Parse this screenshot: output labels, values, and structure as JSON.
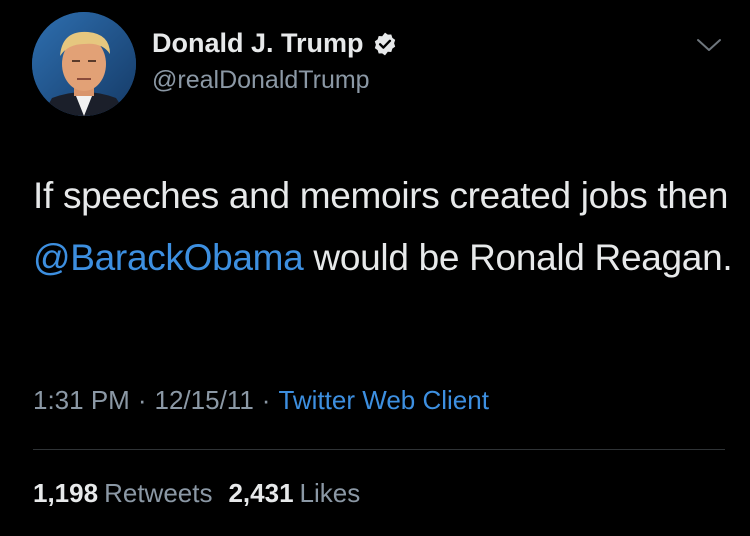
{
  "author": {
    "display_name": "Donald J. Trump",
    "handle": "@realDonaldTrump",
    "verified_icon": "verified-badge-icon",
    "avatar": "profile-photo"
  },
  "tweet": {
    "text_before": "If speeches and memoirs created jobs then ",
    "mention": "@BarackObama",
    "text_after": " would be Ronald Reagan."
  },
  "meta": {
    "time": "1:31 PM",
    "separator": "·",
    "date": "12/15/11",
    "client": "Twitter Web Client"
  },
  "stats": {
    "retweets_count": "1,198",
    "retweets_label": "Retweets",
    "likes_count": "2,431",
    "likes_label": "Likes"
  },
  "colors": {
    "background": "#000000",
    "text": "#e7e9ea",
    "secondary": "#8b98a5",
    "link": "#3d8fe0"
  },
  "icons": {
    "menu": "chevron-down-icon"
  }
}
